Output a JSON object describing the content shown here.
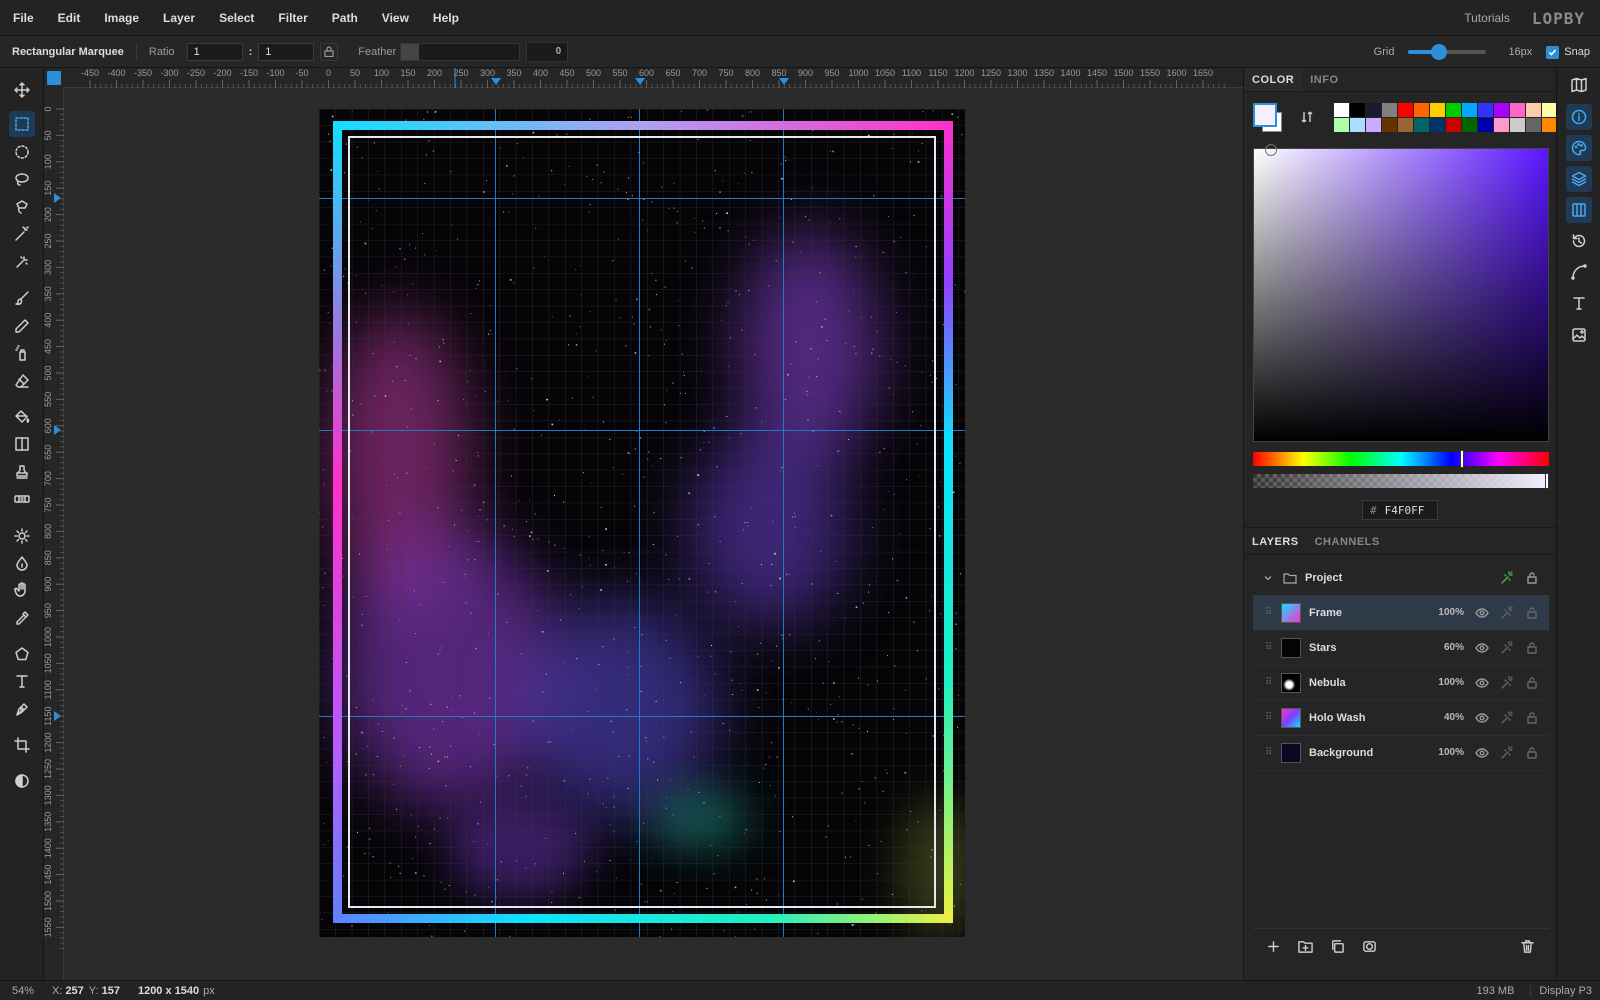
{
  "app": {
    "logo": "LOPBY"
  },
  "menubar": {
    "items": [
      "File",
      "Edit",
      "Image",
      "Layer",
      "Select",
      "Filter",
      "Path",
      "View",
      "Help"
    ],
    "tutorials": "Tutorials"
  },
  "options": {
    "tool_name": "Rectangular Marquee",
    "ratio_label": "Ratio",
    "ratio_w": "1",
    "ratio_colon": ":",
    "ratio_h": "1",
    "feather_label": "Feather",
    "feather_value": "0",
    "feather_fraction": 0,
    "grid_label": "Grid",
    "grid_size": "16px",
    "grid_slider_fraction": 0.32,
    "snap_label": "Snap",
    "snap_checked": true
  },
  "toolbar": {
    "tools": [
      "move-icon",
      "rect-marquee-icon",
      "ellipse-marquee-icon",
      "lasso-icon",
      "polygon-lasso-icon",
      "magic-wand-icon",
      "quick-select-icon",
      "brush-icon",
      "pencil-icon",
      "spray-icon",
      "eraser-icon",
      "paint-bucket-icon",
      "gradient-icon",
      "clone-stamp-icon",
      "healing-icon",
      "dodge-icon",
      "burn-icon",
      "hand-icon",
      "eyedropper-icon",
      "shape-icon",
      "type-icon",
      "pen-icon",
      "crop-icon",
      "contrast-icon"
    ],
    "active": "rect-marquee-icon"
  },
  "rulers": {
    "h_labels": [
      "-450",
      "-400",
      "-350",
      "-300",
      "-250",
      "-200",
      "-150",
      "-100",
      "-50",
      "0",
      "50",
      "100",
      "150",
      "200",
      "250",
      "300",
      "350",
      "400",
      "450",
      "500",
      "550",
      "600",
      "650",
      "700",
      "750",
      "800",
      "850",
      "900",
      "950",
      "1000",
      "1050",
      "1100",
      "1150",
      "1200",
      "1250",
      "1300",
      "1350",
      "1400",
      "1450",
      "1500",
      "1550",
      "1600",
      "1650"
    ],
    "v_labels": [
      "0",
      "50",
      "100",
      "150",
      "200",
      "250",
      "300",
      "350",
      "400",
      "450",
      "500",
      "550",
      "600",
      "650",
      "700",
      "750",
      "800",
      "850",
      "900",
      "950",
      "1000",
      "1050",
      "1100",
      "1150",
      "1200",
      "1250",
      "1300",
      "1350",
      "1400",
      "1450",
      "1500",
      "1550"
    ]
  },
  "canvas": {
    "frame_colors": [
      "#10e0ff",
      "#b060ff",
      "#ff30c8",
      "#20f0c0",
      "#f0f040"
    ],
    "background": "#050507"
  },
  "color_panel": {
    "tabs": [
      "COLOR",
      "INFO"
    ],
    "active_tab": "COLOR",
    "foreground": "#f4f0ff",
    "background": "#ffffff",
    "hex_hash": "#",
    "hex": "F4F0FF",
    "hue_fraction": 0.71,
    "palette": [
      "#ffffff",
      "#000000",
      "#1a1a2e",
      "#808080",
      "#ff0000",
      "#ff6600",
      "#ffcc00",
      "#00cc00",
      "#00aaff",
      "#3333ff",
      "#aa00ff",
      "#ff66cc",
      "#ffccaa",
      "#ffffaa",
      "#aaffaa",
      "#aaddff",
      "#ccaaff",
      "#663300",
      "#996633",
      "#006666",
      "#003366",
      "#cc0000",
      "#006600",
      "#0000aa",
      "#ff99cc",
      "#cccccc",
      "#666666",
      "#ff8800"
    ]
  },
  "layers_panel": {
    "tabs": [
      "LAYERS",
      "CHANNELS"
    ],
    "active_tab": "LAYERS",
    "group": "Project",
    "layers": [
      {
        "name": "Frame",
        "opacity": "100%",
        "selected": true
      },
      {
        "name": "Stars",
        "opacity": "60%",
        "selected": false
      },
      {
        "name": "Nebula",
        "opacity": "100%",
        "selected": false
      },
      {
        "name": "Holo Wash",
        "opacity": "40%",
        "selected": false
      },
      {
        "name": "Background",
        "opacity": "100%",
        "selected": false
      }
    ]
  },
  "iconstrip": {
    "buttons": [
      "map-icon",
      "info-icon",
      "palette-icon",
      "layers-icon",
      "channels-icon",
      "history-icon",
      "curve-icon",
      "type-panel-icon",
      "image-panel-icon"
    ],
    "active": [
      "info-icon",
      "palette-icon",
      "layers-icon",
      "channels-icon"
    ]
  },
  "status": {
    "zoom": "54%",
    "x_label": "X:",
    "x": "257",
    "y_label": "Y:",
    "y": "157",
    "doc_size": "1200 x 1540",
    "doc_unit": "px",
    "memory": "193 MB",
    "color_profile": "Display P3"
  }
}
